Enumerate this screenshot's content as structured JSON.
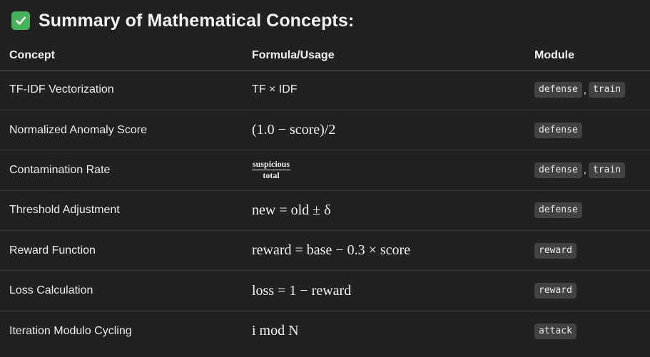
{
  "heading": {
    "icon": "check-mark-icon",
    "text": "Summary of Mathematical Concepts:"
  },
  "table": {
    "headers": {
      "concept": "Concept",
      "formula": "Formula/Usage",
      "module": "Module"
    },
    "rows": [
      {
        "concept": "TF-IDF Vectorization",
        "formula": "TF × IDF",
        "modules": [
          "defense",
          "train"
        ]
      },
      {
        "concept": "Normalized Anomaly Score",
        "formula": "(1.0 − score)/2",
        "modules": [
          "defense"
        ]
      },
      {
        "concept": "Contamination Rate",
        "formula_num": "suspicious",
        "formula_den": "total",
        "modules": [
          "defense",
          "train"
        ]
      },
      {
        "concept": "Threshold Adjustment",
        "formula": "new = old ± δ",
        "modules": [
          "defense"
        ]
      },
      {
        "concept": "Reward Function",
        "formula": "reward = base − 0.3 × score",
        "modules": [
          "reward"
        ]
      },
      {
        "concept": "Loss Calculation",
        "formula": "loss = 1 − reward",
        "modules": [
          "reward"
        ]
      },
      {
        "concept": "Iteration Modulo Cycling",
        "formula": "i mod N",
        "modules": [
          "attack"
        ]
      }
    ],
    "separator": ","
  },
  "colors": {
    "background": "#212121",
    "check": "#44b35b",
    "code_bg": "#424242"
  }
}
